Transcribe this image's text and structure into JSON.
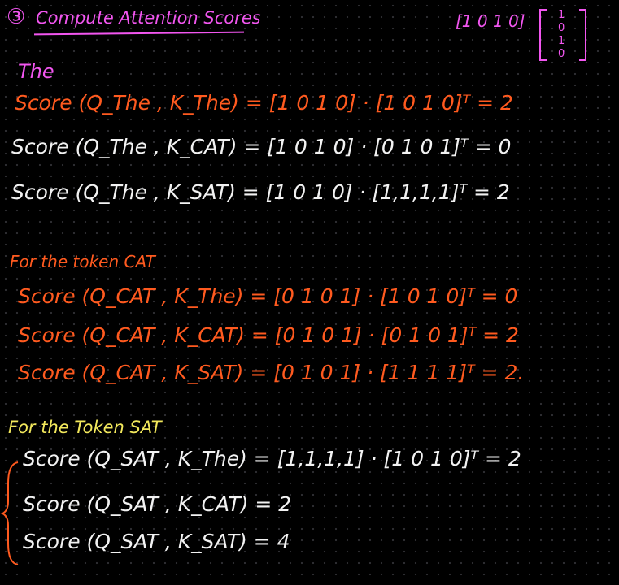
{
  "title": {
    "number": "③",
    "text": "Compute Attention Scores"
  },
  "corner": {
    "row": "[1 0 1 0]",
    "col": [
      "1",
      "0",
      "1",
      "0"
    ]
  },
  "section1": {
    "label": "The",
    "lines": [
      "Score (Q_The , K_The) = [1 0 1 0] · [1 0 1 0]ᵀ = 2",
      "Score (Q_The , K_CAT) = [1 0 1 0] · [0 1 0 1]ᵀ = 0",
      "Score (Q_The , K_SAT) = [1 0 1 0] · [1,1,1,1]ᵀ = 2"
    ]
  },
  "section2": {
    "label": "For the token CAT",
    "lines": [
      "Score (Q_CAT , K_The) = [0 1 0 1] · [1 0 1 0]ᵀ = 0",
      "Score (Q_CAT , K_CAT) = [0 1 0 1] · [0 1 0 1]ᵀ = 2",
      "Score (Q_CAT , K_SAT) = [0 1 0 1] · [1 1 1 1]ᵀ = 2."
    ]
  },
  "section3": {
    "label": "For the Token SAT",
    "lines": [
      "Score (Q_SAT , K_The) = [1,1,1,1] · [1 0 1 0]ᵀ = 2",
      "Score (Q_SAT , K_CAT) = 2",
      "Score (Q_SAT , K_SAT) = 4"
    ]
  },
  "colors": {
    "title": "#f256f0",
    "scores": "#ff5a1f",
    "heading": "#f2e85c",
    "sat_lines": "#f2f2f2",
    "brace": "#ff5a1f"
  }
}
